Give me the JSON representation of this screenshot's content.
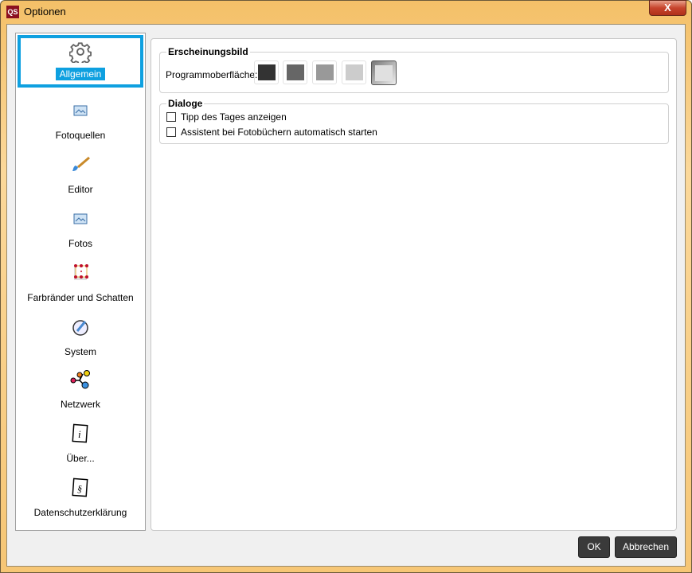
{
  "window": {
    "title": "Optionen",
    "app_icon": "QS",
    "close": "X"
  },
  "sidebar": {
    "items": [
      {
        "label": "Allgemein",
        "icon": "gear-icon",
        "selected": true
      },
      {
        "label": "Fotoquellen",
        "icon": "photo-icon"
      },
      {
        "label": "Editor",
        "icon": "brush-icon"
      },
      {
        "label": "Fotos",
        "icon": "photo-icon"
      },
      {
        "label": "Farbränder und Schatten",
        "icon": "border-shadow-icon"
      },
      {
        "label": "System",
        "icon": "system-icon"
      },
      {
        "label": "Netzwerk",
        "icon": "network-icon"
      },
      {
        "label": "Über...",
        "icon": "info-icon"
      },
      {
        "label": "Datenschutzerklärung",
        "icon": "paragraph-icon"
      }
    ]
  },
  "appearance": {
    "title": "Erscheinungsbild",
    "label": "Programmoberfläche:",
    "swatches": [
      "#333333",
      "#666666",
      "#999999",
      "#cccccc",
      "#e0e0e0"
    ],
    "selected_index": 4
  },
  "dialogs": {
    "title": "Dialoge",
    "options": [
      {
        "label": "Tipp des Tages anzeigen",
        "checked": false
      },
      {
        "label": "Assistent bei Fotobüchern automatisch starten",
        "checked": false
      }
    ]
  },
  "buttons": {
    "ok": "OK",
    "cancel": "Abbrechen"
  }
}
